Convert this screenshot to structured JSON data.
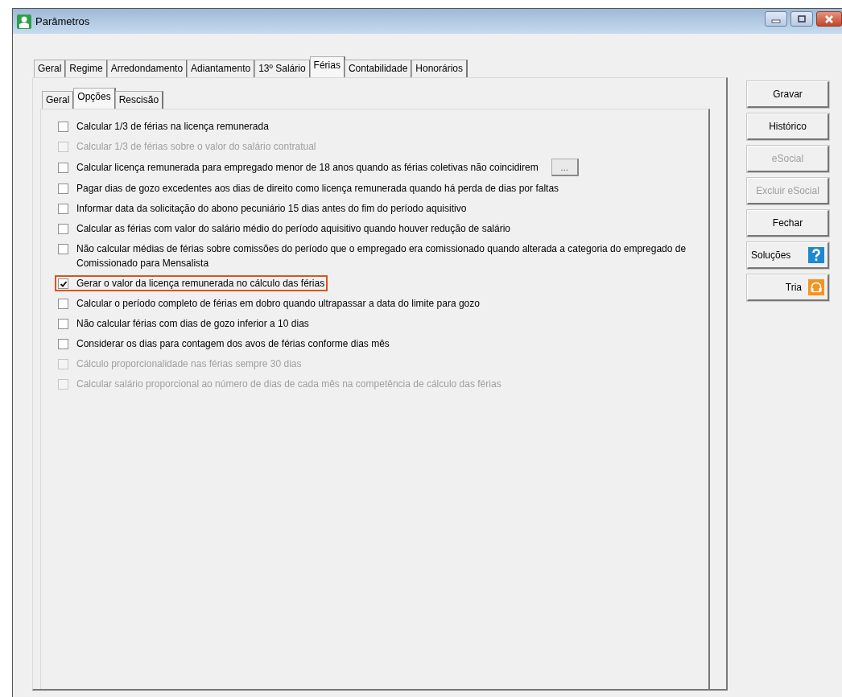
{
  "window": {
    "title": "Parâmetros"
  },
  "tabs": [
    {
      "label": "Geral",
      "selected": false
    },
    {
      "label": "Regime",
      "selected": false
    },
    {
      "label": "Arredondamento",
      "selected": false
    },
    {
      "label": "Adiantamento",
      "selected": false
    },
    {
      "label": "13º Salário",
      "selected": false
    },
    {
      "label": "Férias",
      "selected": true
    },
    {
      "label": "Contabilidade",
      "selected": false
    },
    {
      "label": "Honorários",
      "selected": false
    }
  ],
  "subtabs": [
    {
      "label": "Geral",
      "selected": false
    },
    {
      "label": "Opções",
      "selected": true
    },
    {
      "label": "Rescisão",
      "selected": false
    }
  ],
  "options": [
    {
      "label": "Calcular 1/3 de férias na licença remunerada",
      "checked": false,
      "disabled": false,
      "highlighted": false
    },
    {
      "label": "Calcular 1/3 de férias sobre o valor do salário contratual",
      "checked": false,
      "disabled": true,
      "highlighted": false
    },
    {
      "label": "Calcular licença remunerada para empregado menor de 18 anos quando as férias coletivas não coincidirem",
      "checked": false,
      "disabled": false,
      "highlighted": false,
      "button_label": "..."
    },
    {
      "label": "Pagar dias de gozo excedentes aos dias de direito como licença remunerada quando há perda de dias por faltas",
      "checked": false,
      "disabled": false,
      "highlighted": false
    },
    {
      "label": "Informar data da solicitação do abono pecuniário 15 dias antes do fim do período aquisitivo",
      "checked": false,
      "disabled": false,
      "highlighted": false
    },
    {
      "label": "Calcular as férias com valor do salário médio do período aquisitivo quando houver redução de salário",
      "checked": false,
      "disabled": false,
      "highlighted": false
    },
    {
      "label": "Não calcular médias de férias sobre comissões do período que o empregado era comissionado quando alterada a categoria do empregado de Comissionado para Mensalista",
      "checked": false,
      "disabled": false,
      "highlighted": false
    },
    {
      "label": "Gerar o valor da licença remunerada no cálculo das férias",
      "checked": true,
      "disabled": false,
      "highlighted": true
    },
    {
      "label": "Calcular o período completo de férias em dobro quando ultrapassar a data do limite para gozo",
      "checked": false,
      "disabled": false,
      "highlighted": false
    },
    {
      "label": "Não calcular férias com dias de gozo inferior a 10 dias",
      "checked": false,
      "disabled": false,
      "highlighted": false
    },
    {
      "label": "Considerar os dias para contagem dos avos de férias conforme dias mês",
      "checked": false,
      "disabled": false,
      "highlighted": false
    },
    {
      "label": "Cálculo proporcionalidade nas férias sempre 30 dias",
      "checked": false,
      "disabled": true,
      "highlighted": false
    },
    {
      "label": "Calcular salário proporcional ao número de dias de cada mês na competência de cálculo das férias",
      "checked": false,
      "disabled": true,
      "highlighted": false
    }
  ],
  "buttons": [
    {
      "label": "Gravar",
      "disabled": false,
      "kind": "plain"
    },
    {
      "label": "Histórico",
      "disabled": false,
      "kind": "plain"
    },
    {
      "label": "eSocial",
      "disabled": true,
      "kind": "plain"
    },
    {
      "label": "Excluir eSocial",
      "disabled": true,
      "kind": "plain"
    },
    {
      "label": "Fechar",
      "disabled": false,
      "kind": "plain"
    },
    {
      "label": "Soluções",
      "disabled": false,
      "kind": "help"
    },
    {
      "label": "Tria",
      "disabled": false,
      "kind": "support"
    }
  ]
}
